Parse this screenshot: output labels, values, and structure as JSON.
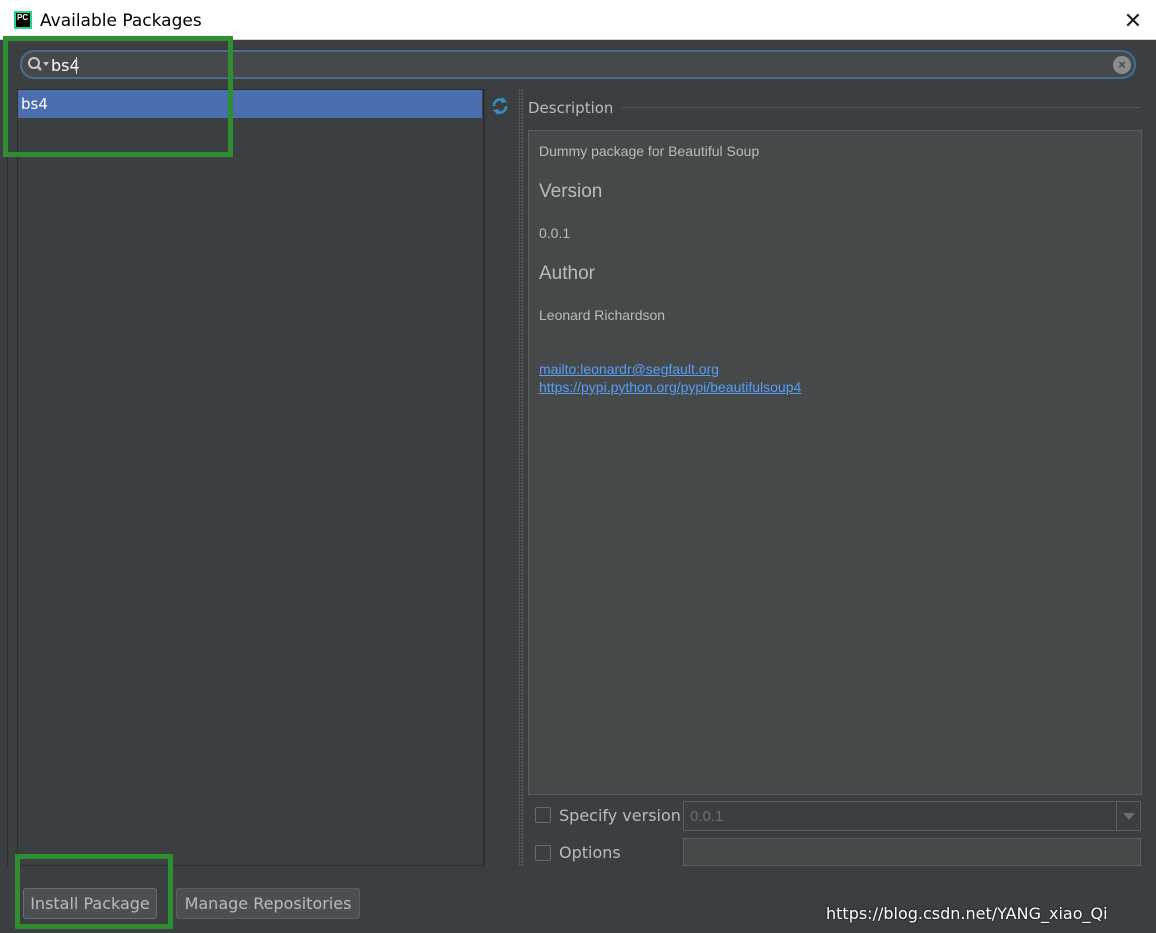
{
  "window": {
    "title": "Available Packages",
    "close_glyph": "✕",
    "app_icon": "PC"
  },
  "search": {
    "value": "bs4",
    "clear_glyph": "×"
  },
  "packages": [
    {
      "name": "bs4",
      "selected": true
    }
  ],
  "description": {
    "section_label": "Description",
    "summary": "Dummy package for Beautiful Soup",
    "version_heading": "Version",
    "version": "0.0.1",
    "author_heading": "Author",
    "author": "Leonard Richardson",
    "links": [
      "mailto:leonardr@segfault.org",
      "https://pypi.python.org/pypi/beautifulsoup4"
    ]
  },
  "options": {
    "specify_version_label": "Specify version",
    "version_value": "0.0.1",
    "options_label": "Options",
    "options_value": ""
  },
  "buttons": {
    "install_label": "Install Package",
    "manage_label": "Manage Repositories"
  },
  "watermark": "https://blog.csdn.net/YANG_xiao_Qi",
  "colors": {
    "selection": "#4b6eaf",
    "highlight_box": "#2f8e2f",
    "link": "#589df6",
    "background": "#3c3f41"
  }
}
